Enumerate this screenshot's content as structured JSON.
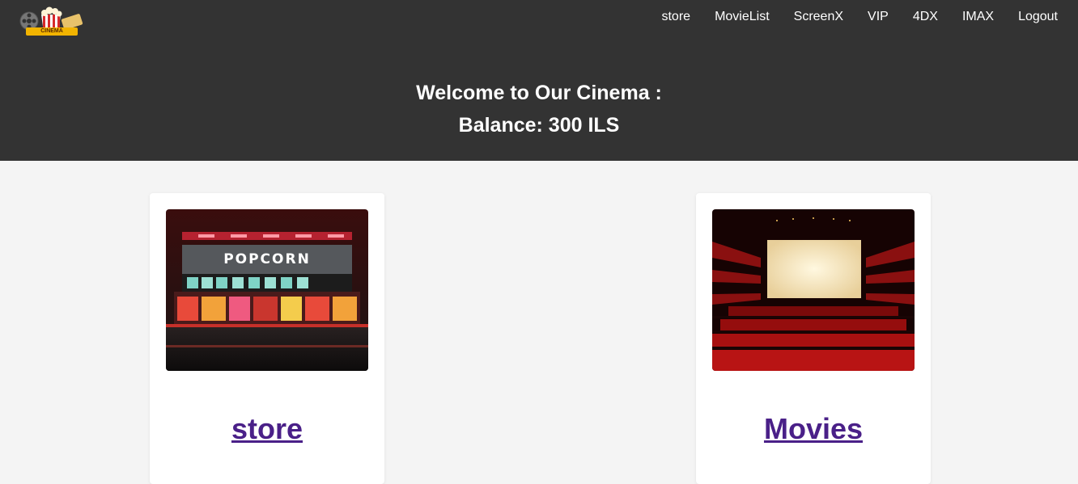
{
  "nav": {
    "items": [
      "store",
      "MovieList",
      "ScreenX",
      "VIP",
      "4DX",
      "IMAX",
      "Logout"
    ]
  },
  "logo": {
    "badge_text": "CINEMA",
    "icon": "cinema-logo-icon"
  },
  "header": {
    "welcome": "Welcome to Our Cinema :",
    "balance": "Balance: 300 ILS"
  },
  "cards": [
    {
      "image_sign": "POPCORN",
      "link": "store"
    },
    {
      "link": "Movies"
    }
  ],
  "colors": {
    "topbar": "#333333",
    "page_bg": "#f4f4f4",
    "link": "#4a2088"
  }
}
